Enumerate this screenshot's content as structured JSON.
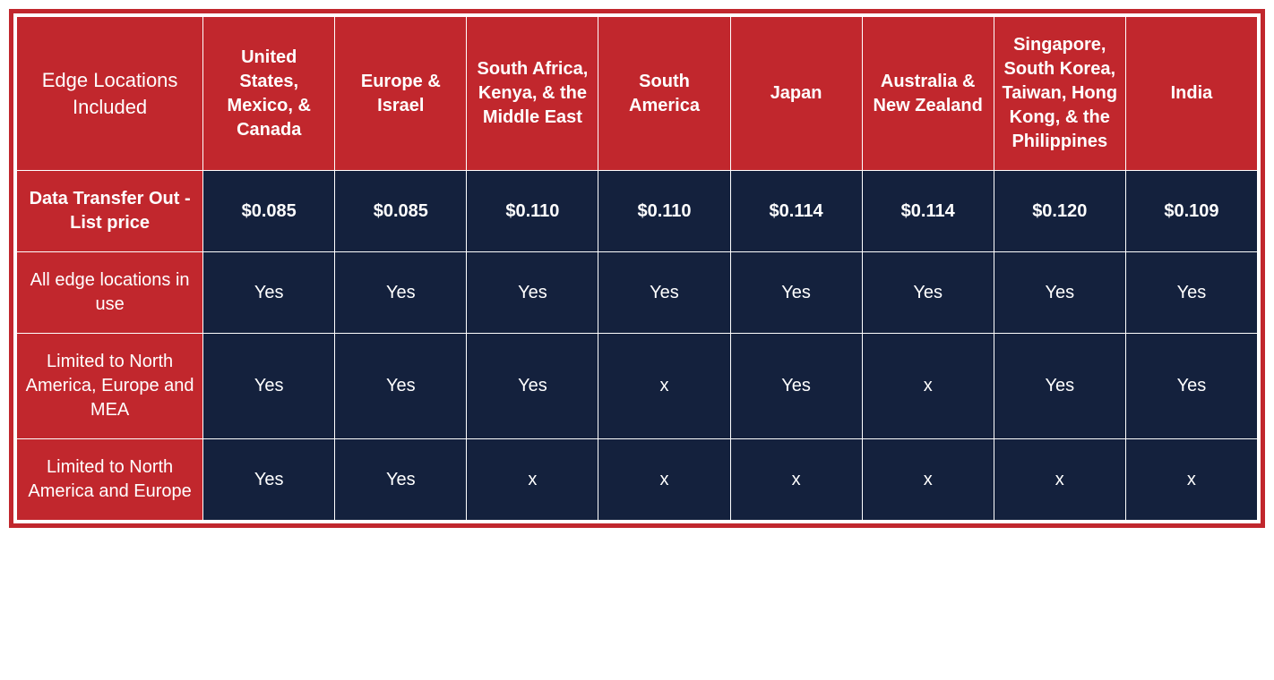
{
  "chart_data": {
    "type": "table",
    "title": "Edge Locations Included",
    "columns": [
      "United States, Mexico, & Canada",
      "Europe & Israel",
      "South Africa, Kenya, & the Middle East",
      "South America",
      "Japan",
      "Australia & New Zealand",
      "Singapore, South Korea, Taiwan, Hong Kong, & the Philippines",
      "India"
    ],
    "rows": [
      {
        "label": "Data Transfer Out - List price",
        "bold": true,
        "values": [
          "$0.085",
          "$0.085",
          "$0.110",
          "$0.110",
          "$0.114",
          "$0.114",
          "$0.120",
          "$0.109"
        ]
      },
      {
        "label": "All edge locations in use",
        "bold": false,
        "values": [
          "Yes",
          "Yes",
          "Yes",
          "Yes",
          "Yes",
          "Yes",
          "Yes",
          "Yes"
        ]
      },
      {
        "label": "Limited to North America, Europe and MEA",
        "bold": false,
        "values": [
          "Yes",
          "Yes",
          "Yes",
          "x",
          "Yes",
          "x",
          "Yes",
          "Yes"
        ]
      },
      {
        "label": "Limited to North America and Europe",
        "bold": false,
        "values": [
          "Yes",
          "Yes",
          "x",
          "x",
          "x",
          "x",
          "x",
          "x"
        ]
      }
    ]
  }
}
